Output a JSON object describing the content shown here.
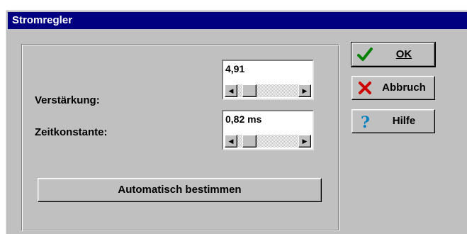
{
  "window": {
    "title": "Stromregler"
  },
  "gain": {
    "label": "Verstärkung:",
    "value": "4,91",
    "scroll_value": 0.1
  },
  "time_constant": {
    "label": "Zeitkonstante:",
    "value": "0,82 ms",
    "scroll_value": 0.1
  },
  "buttons": {
    "auto": "Automatisch bestimmen",
    "ok": "OK",
    "cancel": "Abbruch",
    "help": "Hilfe"
  },
  "icons": {
    "ok": "checkmark-icon",
    "cancel": "red-x-icon",
    "help": "question-mark-icon",
    "scroll_left": "arrow-left-icon",
    "scroll_right": "arrow-right-icon"
  },
  "colors": {
    "titlebar": "#000080",
    "face": "#c0c0c0",
    "ok_check": "#008000",
    "cancel_x": "#cc0000",
    "help_q": "#0080c0"
  }
}
